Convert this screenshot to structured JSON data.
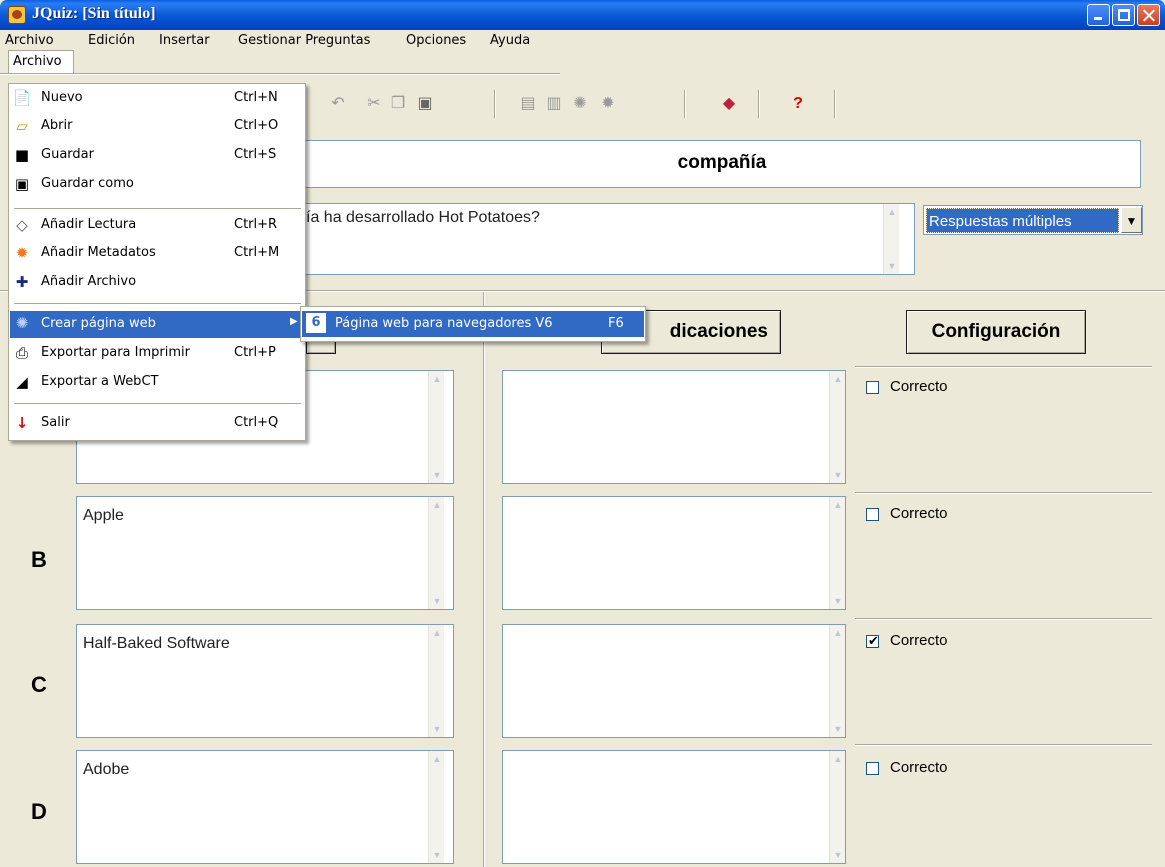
{
  "window": {
    "title": "JQuiz: [Sin título]"
  },
  "menubar": {
    "items": [
      "Archivo",
      "Edición",
      "Insertar",
      "Gestionar Preguntas",
      "Opciones",
      "Ayuda"
    ]
  },
  "question": {
    "title": "compañía",
    "text_visible": "ía ha desarrollado Hot Potatoes?",
    "type": "Respuestas múltiples"
  },
  "headers": {
    "feedback_partial": "dicaciones",
    "settings": "Configuración"
  },
  "answers": [
    {
      "letter": "",
      "text": "",
      "feedback": "",
      "correct_label": "Correcto",
      "correct": false
    },
    {
      "letter": "B",
      "text": "Apple",
      "feedback": "",
      "correct_label": "Correcto",
      "correct": false
    },
    {
      "letter": "C",
      "text": "Half-Baked Software",
      "feedback": "",
      "correct_label": "Correcto",
      "correct": true
    },
    {
      "letter": "D",
      "text": "Adobe",
      "feedback": "",
      "correct_label": "Correcto",
      "correct": false
    }
  ],
  "file_menu": {
    "items": [
      {
        "label": "Nuevo",
        "shortcut": "Ctrl+N",
        "icon": "new-file-icon"
      },
      {
        "label": "Abrir",
        "shortcut": "Ctrl+O",
        "icon": "open-folder-icon"
      },
      {
        "label": "Guardar",
        "shortcut": "Ctrl+S",
        "icon": "save-disk-icon"
      },
      {
        "label": "Guardar como",
        "shortcut": "",
        "icon": "save-as-icon"
      },
      {
        "label": "Añadir Lectura",
        "shortcut": "Ctrl+R",
        "icon": "reading-icon"
      },
      {
        "label": "Añadir Metadatos",
        "shortcut": "Ctrl+M",
        "icon": "metadata-icon"
      },
      {
        "label": "Añadir Archivo",
        "shortcut": "",
        "icon": "plus-icon"
      },
      {
        "label": "Crear página web",
        "shortcut": "",
        "icon": "web-page-icon"
      },
      {
        "label": "Exportar para Imprimir",
        "shortcut": "Ctrl+P",
        "icon": "printer-icon"
      },
      {
        "label": "Exportar a WebCT",
        "shortcut": "",
        "icon": "webct-icon"
      },
      {
        "label": "Salir",
        "shortcut": "Ctrl+Q",
        "icon": "exit-arrow-icon"
      }
    ],
    "submenu": {
      "label": "Página web para navegadores V6",
      "shortcut": "F6",
      "icon": "web-v6-icon"
    }
  },
  "colors": {
    "menu_highlight": "#316ac5",
    "titlebar": "#0b5ad8",
    "background": "#ece9d8"
  }
}
